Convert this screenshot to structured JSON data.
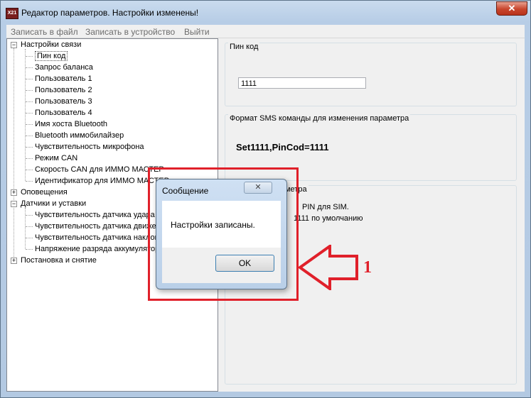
{
  "window": {
    "title": "Редактор параметров. Настройки изменены!",
    "app_icon_text": "X21",
    "close_glyph": "✕"
  },
  "menu": {
    "items": [
      "Записать в файл",
      "Записать в устройство",
      "Выйти"
    ]
  },
  "tree": {
    "expand_glyph": "+",
    "collapse_glyph": "−",
    "nodes": [
      "Настройки связи",
      "Пин код",
      "Запрос баланса",
      "Пользователь 1",
      "Пользователь 2",
      "Пользователь 3",
      "Пользователь 4",
      "Имя хоста Bluetooth",
      "Bluetooth иммобилайзер",
      "Чувствительность микрофона",
      "Режим CAN",
      "Скорость CAN для ИММО МАСТЕР",
      "Идентификатор для ИММО МАСТЕР",
      "Оповещения",
      "Датчики и уставки",
      "Чувствительность датчика удара",
      "Чувствительность датчика движения",
      "Чувствительность датчика наклона",
      "Напряжение разряда аккумулятора",
      "Постановка и снятие"
    ]
  },
  "panel": {
    "pin_group_title": "Пин код",
    "pin_value": "1111",
    "sms_group_title": "Формат SMS команды для изменения параметра",
    "sms_command": "Set1111,PinCod=1111",
    "desc_group_title_visible": "Описание параметра",
    "desc_line1_visible": "PIN для SIM.",
    "desc_line2_visible": "1111 по умолчанию"
  },
  "dialog": {
    "title": "Сообщение",
    "close_glyph": "✕",
    "message": "Настройки записаны.",
    "ok_label": "OK"
  },
  "annotation": {
    "marker": "1",
    "color": "#e0202a"
  }
}
